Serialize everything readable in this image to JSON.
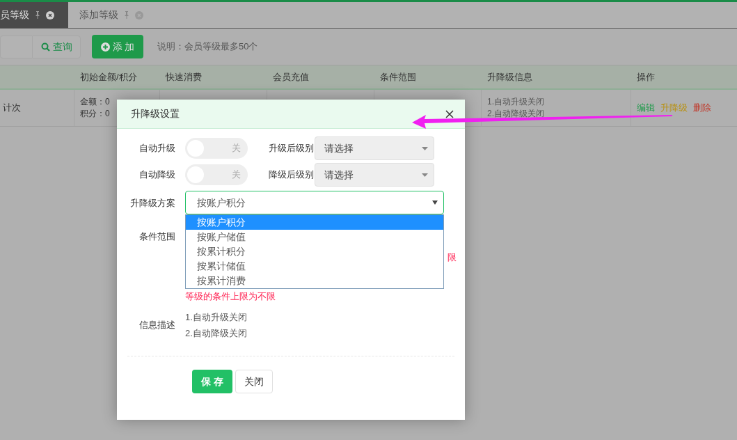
{
  "tabs": [
    {
      "label": "员等级",
      "selected": true
    },
    {
      "label": "添加等级",
      "selected": false
    }
  ],
  "toolbar": {
    "search_button": "查询",
    "add_button": "添 加",
    "note": "说明：会员等级最多50个"
  },
  "table": {
    "columns": [
      "初始金额/积分",
      "快速消费",
      "会员充值",
      "条件范围",
      "升降级信息",
      "操作"
    ],
    "rows": [
      {
        "type": "计次",
        "initial": [
          "金额：0",
          "积分：0"
        ],
        "info": [
          "1.自动升级关闭",
          "2.自动降级关闭"
        ],
        "actions": [
          {
            "label": "编辑",
            "color": "#1e9a4a"
          },
          {
            "label": "升降级",
            "color": "#b8900e"
          },
          {
            "label": "删除",
            "color": "#c0392b"
          }
        ]
      }
    ]
  },
  "dialog": {
    "title": "升降级设置",
    "rows": [
      {
        "label": "自动升级",
        "on": false,
        "toggle_text": "关",
        "select_label": "升级后级别",
        "select_placeholder": "请选择"
      },
      {
        "label": "自动降级",
        "on": false,
        "toggle_text": "关",
        "select_label": "降级后级别",
        "select_placeholder": "请选择"
      }
    ],
    "scheme": {
      "label": "升降级方案",
      "value": "按账户积分",
      "expanded": true,
      "options": [
        {
          "label": "按账户积分",
          "selected": true
        },
        {
          "label": "按账户储值",
          "selected": false
        },
        {
          "label": "按累计积分",
          "selected": false
        },
        {
          "label": "按累计储值",
          "selected": false
        },
        {
          "label": "按累计消费",
          "selected": false
        }
      ]
    },
    "range": {
      "label": "条件范围",
      "notes": [
        "限",
        "等级的条件上限为不限"
      ]
    },
    "info": {
      "label": "信息描述",
      "lines": [
        "1.自动升级关闭",
        "2.自动降级关闭"
      ]
    },
    "buttons": [
      {
        "label": "保 存",
        "kind": "primary"
      },
      {
        "label": "关闭",
        "kind": "default"
      }
    ]
  }
}
